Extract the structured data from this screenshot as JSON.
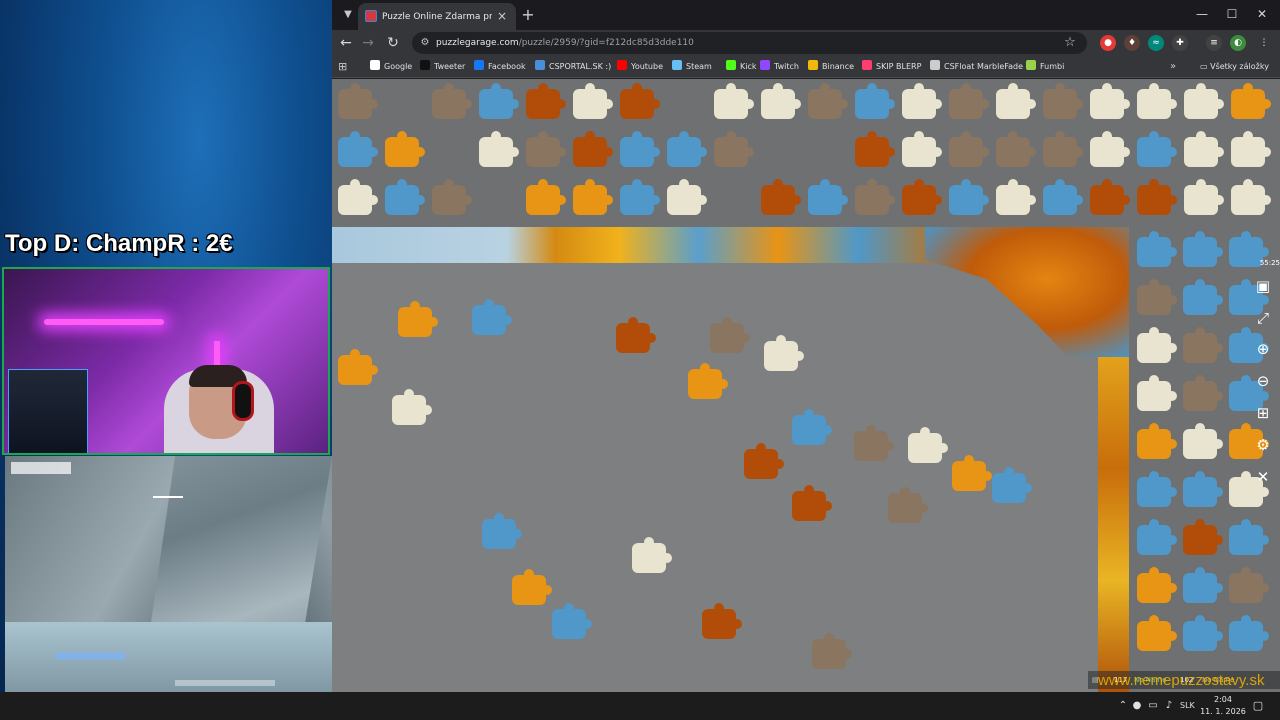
{
  "overlay": {
    "top_donor": "Top D: ChampR : 2€"
  },
  "browser": {
    "tab": {
      "title": "Puzzle Online Zdarma pre Dosp",
      "favicon": "puzzle-favicon"
    },
    "address": {
      "host": "puzzlegarage.com",
      "path": "/puzzle/2959/?gid=f212dc85d3dde110"
    },
    "bookmarks": [
      {
        "label": "Google",
        "color": "#ffffff"
      },
      {
        "label": "Tweeter",
        "color": "#111111"
      },
      {
        "label": "Facebook",
        "color": "#1877f2"
      },
      {
        "label": "CSPORTAL.SK :)",
        "color": "#4a8fd9"
      },
      {
        "label": "Youtube",
        "color": "#ff0000"
      },
      {
        "label": "Steam",
        "color": "#66c0f4"
      },
      {
        "label": "Kick",
        "color": "#53fc18"
      },
      {
        "label": "Twitch",
        "color": "#9146ff"
      },
      {
        "label": "Binance",
        "color": "#f0b90b"
      },
      {
        "label": "SKIP BLERP",
        "color": "#ff3d6e"
      },
      {
        "label": "CSFloat MarbleFade",
        "color": "#cccccc"
      },
      {
        "label": "Fumbi",
        "color": "#9ad14a"
      }
    ],
    "bookmarks_all": "Všetky záložky",
    "extensions": [
      {
        "name": "record-icon",
        "color": "#e53935"
      },
      {
        "name": "extension-icon-2",
        "color": "#8d6e63"
      },
      {
        "name": "extension-icon-3",
        "color": "#26a69a"
      },
      {
        "name": "puzzle-extension-icon",
        "color": "#9e9e9e"
      },
      {
        "name": "media-icon",
        "color": "#9e9e9e"
      },
      {
        "name": "profile-avatar",
        "color": "#3d8b3d"
      }
    ]
  },
  "puzzle": {
    "timer": "55:25",
    "tools": [
      "preview-icon",
      "fullscreen-icon",
      "zoom-in-icon",
      "zoom-out-icon",
      "sort-pieces-icon",
      "settings-icon",
      "close-icon"
    ],
    "bottom_bar": {
      "pieces": "117",
      "player1": "No Name",
      "player1_count": "102",
      "player2": "No Name"
    },
    "watermark": "www.nemepuzzostavy.sk",
    "colors": {
      "sky": "#4f98c9",
      "leaf": "#e89414",
      "leaf_dark": "#b24d09",
      "cream": "#e9e4cf",
      "stone": "#8a7560",
      "board": "#7d7f81"
    }
  },
  "taskbar": {
    "language": "SLK",
    "time": "2:04",
    "date": "11. 1. 2026"
  }
}
